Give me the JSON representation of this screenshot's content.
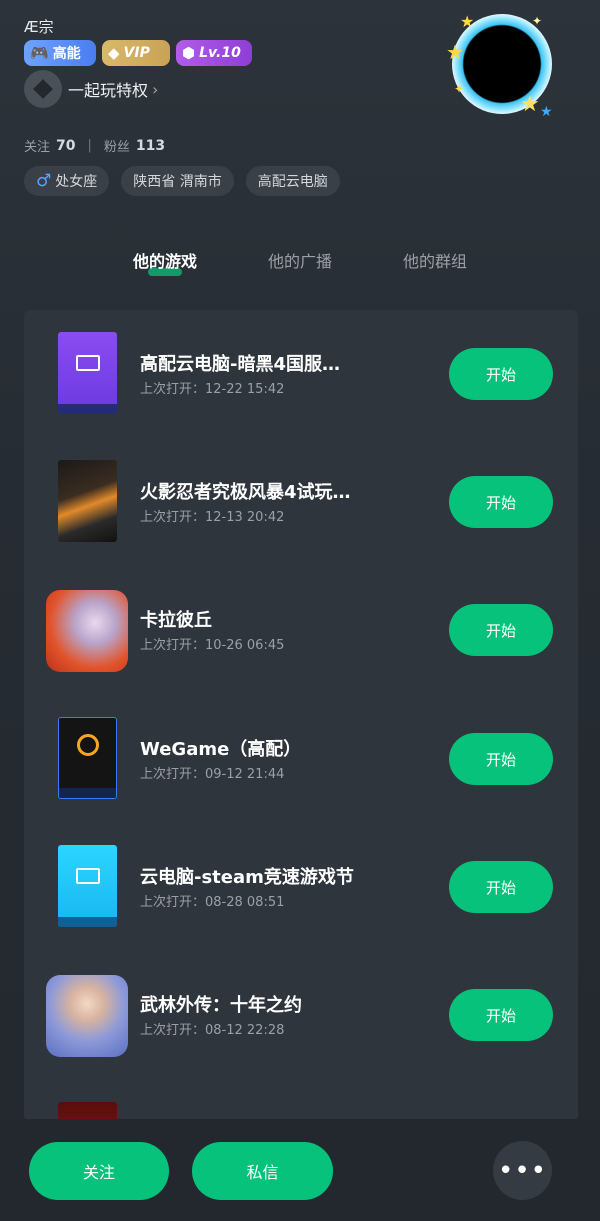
{
  "profile": {
    "nickname": "Æ宗",
    "badges": {
      "gaoneng": "高能",
      "vip": "VIP",
      "level": "Lv.10"
    },
    "privilege_label": "一起玩特权",
    "follow_label": "关注",
    "follow_count": "70",
    "fans_label": "粉丝",
    "fans_count": "113",
    "tags": [
      "处女座",
      "陕西省 渭南市",
      "高配云电脑"
    ]
  },
  "tabs": [
    "他的游戏",
    "他的广播",
    "他的群组"
  ],
  "active_tab_index": 0,
  "games": [
    {
      "title": "高配云电脑-暗黑4国服…",
      "last_open": "上次打开：12-22 15:42",
      "button": "开始",
      "icon": "cloud-pc-purple-icon"
    },
    {
      "title": "火影忍者究极风暴4试玩…",
      "last_open": "上次打开：12-13 20:42",
      "button": "开始",
      "icon": "naruto-cover-icon"
    },
    {
      "title": "卡拉彼丘",
      "last_open": "上次打开：10-26 06:45",
      "button": "开始",
      "icon": "strinova-app-icon"
    },
    {
      "title": "WeGame（高配）",
      "last_open": "上次打开：09-12 21:44",
      "button": "开始",
      "icon": "wegame-icon"
    },
    {
      "title": "云电脑-steam竞速游戏节",
      "last_open": "上次打开：08-28 08:51",
      "button": "开始",
      "icon": "cloud-pc-cyan-icon"
    },
    {
      "title": "武林外传：十年之约",
      "last_open": "上次打开：08-12 22:28",
      "button": "开始",
      "icon": "wulin-app-icon"
    }
  ],
  "bottom_bar": {
    "follow_button": "关注",
    "message_button": "私信",
    "more_button": "•••"
  },
  "colors": {
    "accent_green": "#07c27a",
    "background": "#262c33",
    "panel": "#2e353d"
  }
}
